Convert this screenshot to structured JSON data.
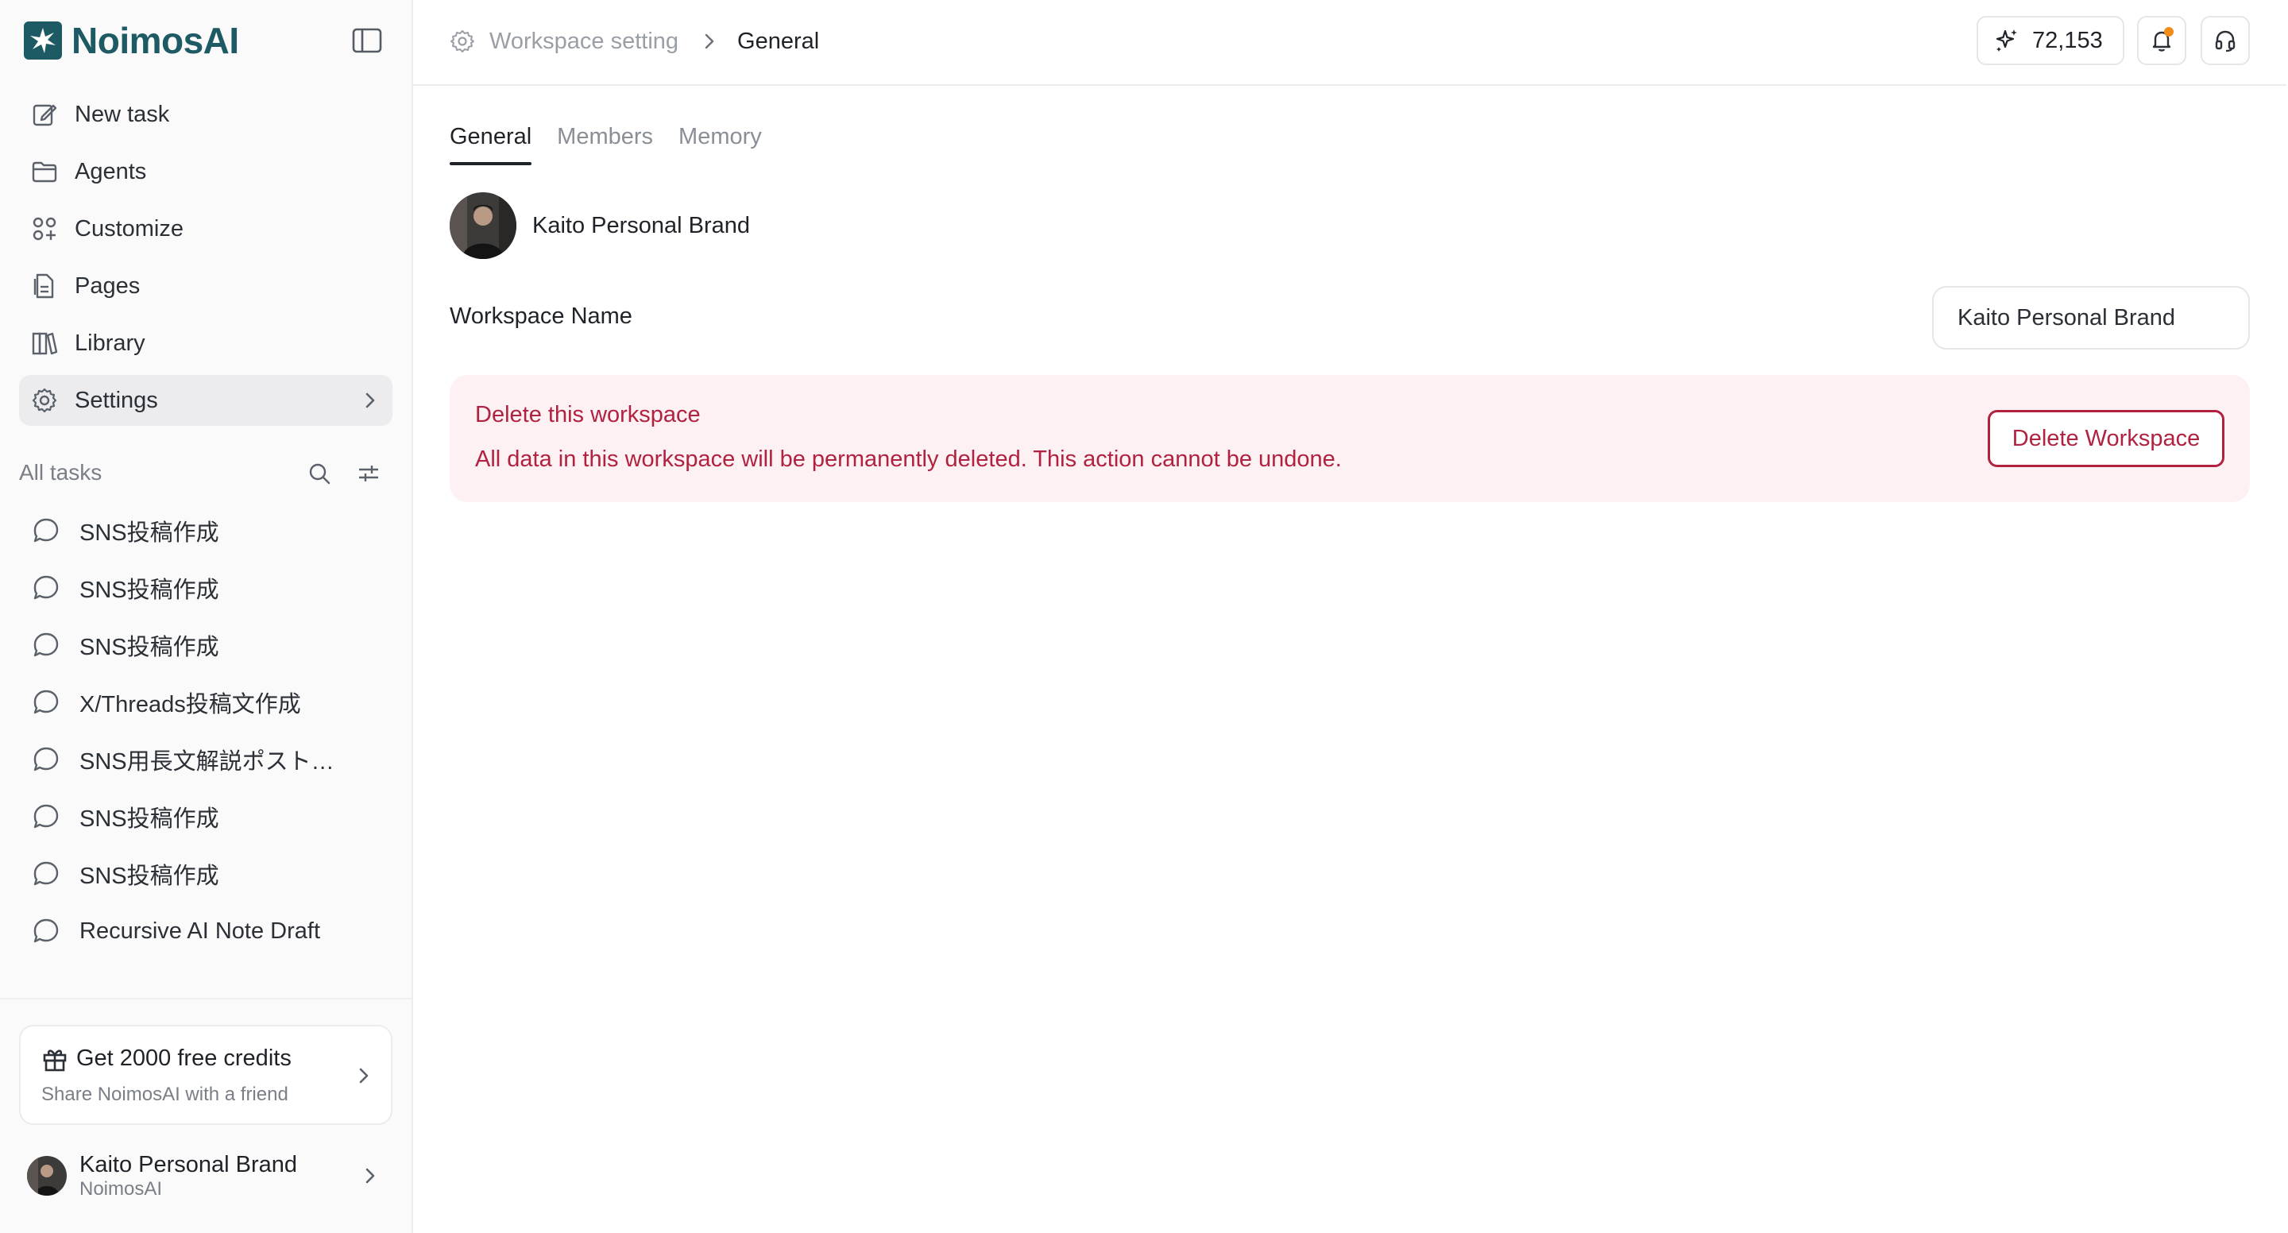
{
  "brand": {
    "name": "NoimosAI",
    "color": "#1d5a63"
  },
  "nav": {
    "items": [
      {
        "label": "New task",
        "icon": "edit-icon"
      },
      {
        "label": "Agents",
        "icon": "folder-icon"
      },
      {
        "label": "Customize",
        "icon": "grid-plus-icon"
      },
      {
        "label": "Pages",
        "icon": "document-icon"
      },
      {
        "label": "Library",
        "icon": "library-icon"
      },
      {
        "label": "Settings",
        "icon": "gear-icon",
        "active": true
      }
    ]
  },
  "tasks": {
    "header": "All tasks",
    "items": [
      "SNS投稿作成",
      "SNS投稿作成",
      "SNS投稿作成",
      "X/Threads投稿文作成",
      "SNS用長文解説ポストの作成",
      "SNS投稿作成",
      "SNS投稿作成",
      "Recursive AI Note Draft"
    ]
  },
  "promo": {
    "title": "Get 2000 free credits",
    "subtitle": "Share NoimosAI with a friend"
  },
  "account": {
    "name": "Kaito Personal Brand",
    "org": "NoimosAI"
  },
  "breadcrumb": {
    "parent": "Workspace setting",
    "current": "General"
  },
  "credits": {
    "value": "72,153"
  },
  "tabs": [
    {
      "label": "General",
      "active": true
    },
    {
      "label": "Members"
    },
    {
      "label": "Memory"
    }
  ],
  "workspace": {
    "display_name": "Kaito Personal Brand",
    "name_label": "Workspace Name",
    "name_value": "Kaito Personal Brand"
  },
  "danger": {
    "title": "Delete this workspace",
    "description": "All data in this workspace will be permanently deleted. This action cannot be undone.",
    "button": "Delete Workspace",
    "color": "#b0223f"
  }
}
